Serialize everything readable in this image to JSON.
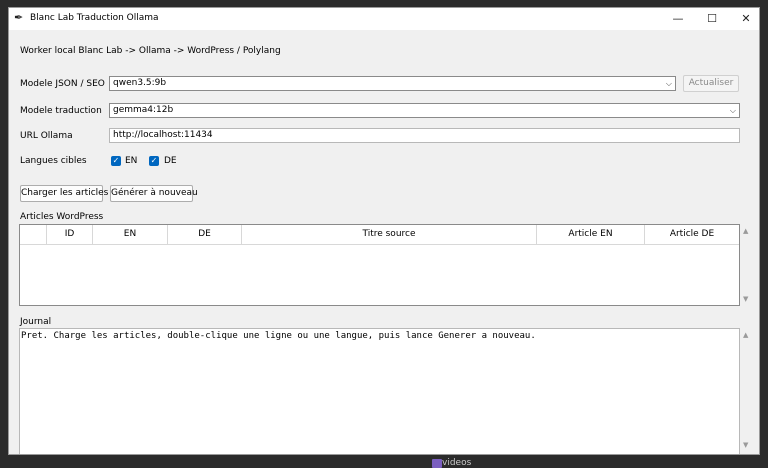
{
  "window": {
    "title": "Blanc Lab Traduction Ollama",
    "icon": "feather-icon",
    "controls": {
      "minimize": "—",
      "maximize": "☐",
      "close": "✕"
    }
  },
  "header": {
    "pipeline": "Worker local Blanc Lab -> Ollama -> WordPress / Polylang"
  },
  "form": {
    "json_model_label": "Modele JSON / SEO",
    "json_model_value": "qwen3.5:9b",
    "refresh_label": "Actualiser",
    "translation_model_label": "Modele traduction",
    "translation_model_value": "gemma4:12b",
    "ollama_url_label": "URL Ollama",
    "ollama_url_value": "http://localhost:11434",
    "target_langs_label": "Langues cibles",
    "lang_en": "EN",
    "lang_de": "DE"
  },
  "actions": {
    "load_articles": "Charger les articles",
    "regenerate": "Générer à nouveau"
  },
  "articles": {
    "section_label": "Articles WordPress",
    "columns": [
      "ID",
      "EN",
      "DE",
      "Titre source",
      "Article EN",
      "Article DE"
    ],
    "rows": []
  },
  "journal": {
    "section_label": "Journal",
    "text": "Pret. Charge les articles, double-clique une ligne ou une langue, puis lance Generer a nouveau."
  },
  "taskbar": {
    "fragment": "videos"
  },
  "colors": {
    "checkbox": "#0067c0",
    "window_bg": "#f0f0f0"
  }
}
